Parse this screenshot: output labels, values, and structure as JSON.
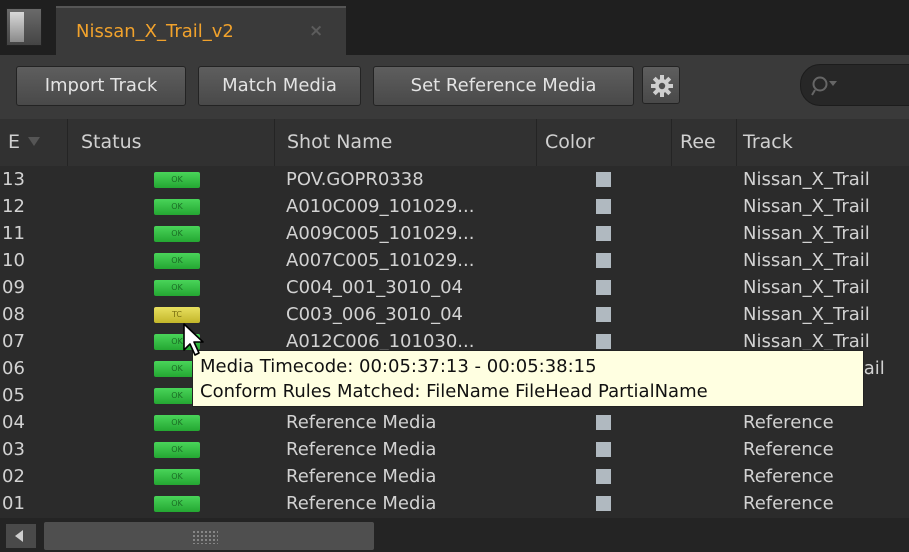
{
  "tab": {
    "title": "Nissan_X_Trail_v2",
    "close": "×"
  },
  "toolbar": {
    "import_track": "Import Track",
    "match_media": "Match Media",
    "set_reference_media": "Set Reference Media",
    "settings_icon": "gear-icon",
    "search_icon": "search-icon"
  },
  "table": {
    "headers": {
      "event": "E",
      "status": "Status",
      "shot_name": "Shot Name",
      "color": "Color",
      "reel": "Ree",
      "track": "Track"
    },
    "rows": [
      {
        "num": "13",
        "status": "OK",
        "shot": "POV.GOPR0338",
        "track": "Nissan_X_Trail"
      },
      {
        "num": "12",
        "status": "OK",
        "shot": "A010C009_101029...",
        "track": "Nissan_X_Trail"
      },
      {
        "num": "11",
        "status": "OK",
        "shot": "A009C005_101029...",
        "track": "Nissan_X_Trail"
      },
      {
        "num": "10",
        "status": "OK",
        "shot": "A007C005_101029...",
        "track": "Nissan_X_Trail"
      },
      {
        "num": "09",
        "status": "OK",
        "shot": "C004_001_3010_04",
        "track": "Nissan_X_Trail"
      },
      {
        "num": "08",
        "status": "TC",
        "shot": "C003_006_3010_04",
        "track": "Nissan_X_Trail"
      },
      {
        "num": "07",
        "status": "OK",
        "shot": "A012C006_101030...",
        "track": "Nissan_X_Trail"
      },
      {
        "num": "06",
        "status": "OK",
        "shot": "",
        "track": "Trail"
      },
      {
        "num": "05",
        "status": "OK",
        "shot": "",
        "track": ""
      },
      {
        "num": "04",
        "status": "OK",
        "shot": "Reference Media",
        "track": "Reference"
      },
      {
        "num": "03",
        "status": "OK",
        "shot": "Reference Media",
        "track": "Reference"
      },
      {
        "num": "02",
        "status": "OK",
        "shot": "Reference Media",
        "track": "Reference"
      },
      {
        "num": "01",
        "status": "OK",
        "shot": "Reference Media",
        "track": "Reference"
      }
    ]
  },
  "tooltip": {
    "line1": "Media Timecode: 00:05:37:13 - 00:05:38:15",
    "line2": "Conform Rules Matched: FileName FileHead PartialName"
  },
  "colors": {
    "tab_title": "#f1a22c",
    "ok_badge": "#3cc44a",
    "tc_badge": "#d8cf44",
    "swatch": "#b0b9c0",
    "tooltip_bg": "#ffffe1"
  }
}
